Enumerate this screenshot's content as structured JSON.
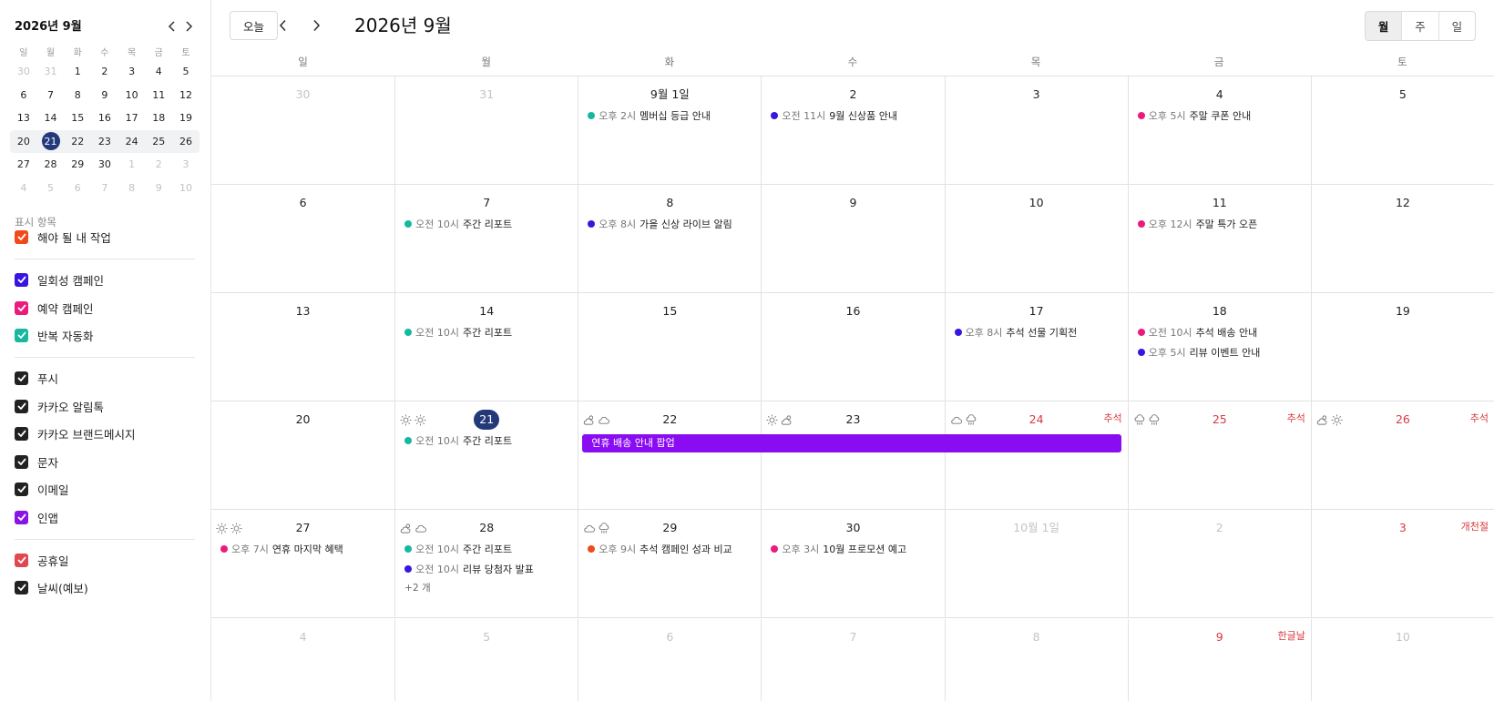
{
  "sidebar": {
    "mini_title": "2026년 9월",
    "dow": [
      "일",
      "월",
      "화",
      "수",
      "목",
      "금",
      "토"
    ],
    "weeks": [
      [
        {
          "d": "30",
          "m": true
        },
        {
          "d": "31",
          "m": true
        },
        {
          "d": "1"
        },
        {
          "d": "2"
        },
        {
          "d": "3"
        },
        {
          "d": "4"
        },
        {
          "d": "5"
        }
      ],
      [
        {
          "d": "6"
        },
        {
          "d": "7"
        },
        {
          "d": "8"
        },
        {
          "d": "9"
        },
        {
          "d": "10"
        },
        {
          "d": "11"
        },
        {
          "d": "12"
        }
      ],
      [
        {
          "d": "13"
        },
        {
          "d": "14"
        },
        {
          "d": "15"
        },
        {
          "d": "16"
        },
        {
          "d": "17"
        },
        {
          "d": "18"
        },
        {
          "d": "19"
        }
      ],
      [
        {
          "d": "20"
        },
        {
          "d": "21",
          "today": true
        },
        {
          "d": "22"
        },
        {
          "d": "23"
        },
        {
          "d": "24"
        },
        {
          "d": "25"
        },
        {
          "d": "26"
        }
      ],
      [
        {
          "d": "27"
        },
        {
          "d": "28"
        },
        {
          "d": "29"
        },
        {
          "d": "30"
        },
        {
          "d": "1",
          "m": true
        },
        {
          "d": "2",
          "m": true
        },
        {
          "d": "3",
          "m": true
        }
      ],
      [
        {
          "d": "4",
          "m": true
        },
        {
          "d": "5",
          "m": true
        },
        {
          "d": "6",
          "m": true
        },
        {
          "d": "7",
          "m": true
        },
        {
          "d": "8",
          "m": true
        },
        {
          "d": "9",
          "m": true
        },
        {
          "d": "10",
          "m": true
        }
      ]
    ],
    "section_label": "표시 항목",
    "filters": [
      {
        "label": "해야 될 내 작업",
        "color": "#f04a1a"
      },
      {
        "label": "일회성 캠페인",
        "color": "#3a14e0"
      },
      {
        "label": "예약 캠페인",
        "color": "#ec1a7c"
      },
      {
        "label": "반복 자동화",
        "color": "#16b8a0"
      },
      {
        "label": "푸시",
        "color": "#222222"
      },
      {
        "label": "카카오 알림톡",
        "color": "#222222"
      },
      {
        "label": "카카오 브랜드메시지",
        "color": "#222222"
      },
      {
        "label": "문자",
        "color": "#222222"
      },
      {
        "label": "이메일",
        "color": "#222222"
      },
      {
        "label": "인앱",
        "color": "#8a14e6"
      },
      {
        "label": "공휴일",
        "color": "#e0474f"
      },
      {
        "label": "날씨(예보)",
        "color": "#222222"
      }
    ]
  },
  "toolbar": {
    "today_label": "오늘",
    "title": "2026년 9월",
    "views": [
      {
        "label": "월",
        "active": true
      },
      {
        "label": "주",
        "active": false
      },
      {
        "label": "일",
        "active": false
      }
    ]
  },
  "calendar": {
    "dow": [
      "일",
      "월",
      "화",
      "수",
      "목",
      "금",
      "토"
    ],
    "weeks": [
      [
        {
          "label": "30",
          "muted": true
        },
        {
          "label": "31",
          "muted": true
        },
        {
          "label": "9월 1일",
          "events": [
            {
              "color": "#16b8a0",
              "time": "오후 2시",
              "title": "멤버십 등급 안내"
            }
          ]
        },
        {
          "label": "2",
          "events": [
            {
              "color": "#3a14e0",
              "time": "오전 11시",
              "title": "9월 신상품 안내"
            }
          ]
        },
        {
          "label": "3"
        },
        {
          "label": "4",
          "events": [
            {
              "color": "#ec1a7c",
              "time": "오후 5시",
              "title": "주말 쿠폰 안내"
            }
          ]
        },
        {
          "label": "5"
        }
      ],
      [
        {
          "label": "6"
        },
        {
          "label": "7",
          "events": [
            {
              "color": "#16b8a0",
              "time": "오전 10시",
              "title": "주간 리포트"
            }
          ]
        },
        {
          "label": "8",
          "events": [
            {
              "color": "#3a14e0",
              "time": "오후 8시",
              "title": "가을 신상 라이브 알림"
            }
          ]
        },
        {
          "label": "9"
        },
        {
          "label": "10"
        },
        {
          "label": "11",
          "events": [
            {
              "color": "#ec1a7c",
              "time": "오후 12시",
              "title": "주말 특가 오픈"
            }
          ]
        },
        {
          "label": "12"
        }
      ],
      [
        {
          "label": "13"
        },
        {
          "label": "14",
          "events": [
            {
              "color": "#16b8a0",
              "time": "오전 10시",
              "title": "주간 리포트"
            }
          ]
        },
        {
          "label": "15"
        },
        {
          "label": "16"
        },
        {
          "label": "17",
          "events": [
            {
              "color": "#3a14e0",
              "time": "오후 8시",
              "title": "추석 선물 기획전"
            }
          ]
        },
        {
          "label": "18",
          "events": [
            {
              "color": "#ec1a7c",
              "time": "오전 10시",
              "title": "추석 배송 안내"
            },
            {
              "color": "#3a14e0",
              "time": "오후 5시",
              "title": "리뷰 이벤트 안내"
            }
          ]
        },
        {
          "label": "19"
        }
      ],
      [
        {
          "label": "20"
        },
        {
          "label": "21",
          "today": true,
          "weather": [
            "sun",
            "sun"
          ],
          "events": [
            {
              "color": "#16b8a0",
              "time": "오전 10시",
              "title": "주간 리포트"
            }
          ]
        },
        {
          "label": "22",
          "weather": [
            "partly",
            "cloud"
          ]
        },
        {
          "label": "23",
          "weather": [
            "sun",
            "partly"
          ]
        },
        {
          "label": "24",
          "red": true,
          "holiday": "추석",
          "weather": [
            "cloud",
            "rain"
          ]
        },
        {
          "label": "25",
          "red": true,
          "holiday": "추석",
          "weather": [
            "rain",
            "rain"
          ]
        },
        {
          "label": "26",
          "red": true,
          "holiday": "추석",
          "weather": [
            "partly",
            "sun"
          ]
        }
      ],
      [
        {
          "label": "27",
          "weather": [
            "sun",
            "sun"
          ],
          "events": [
            {
              "color": "#ec1a7c",
              "time": "오후 7시",
              "title": "연휴 마지막 혜택"
            }
          ]
        },
        {
          "label": "28",
          "weather": [
            "partly",
            "cloud"
          ],
          "events": [
            {
              "color": "#16b8a0",
              "time": "오전 10시",
              "title": "주간 리포트"
            },
            {
              "color": "#3a14e0",
              "time": "오전 10시",
              "title": "리뷰 당첨자 발표"
            }
          ],
          "more": "+2 개"
        },
        {
          "label": "29",
          "weather": [
            "cloud",
            "rain"
          ],
          "events": [
            {
              "color": "#f04a1a",
              "time": "오후 9시",
              "title": "추석 캠페인 성과 비교"
            }
          ]
        },
        {
          "label": "30",
          "events": [
            {
              "color": "#ec1a7c",
              "time": "오후 3시",
              "title": "10월 프로모션 예고"
            }
          ]
        },
        {
          "label": "10월 1일",
          "muted": true
        },
        {
          "label": "2",
          "muted": true
        },
        {
          "label": "3",
          "red": true,
          "holiday": "개천절"
        }
      ],
      [
        {
          "label": "4",
          "muted": true
        },
        {
          "label": "5",
          "muted": true
        },
        {
          "label": "6",
          "muted": true
        },
        {
          "label": "7",
          "muted": true
        },
        {
          "label": "8",
          "muted": true
        },
        {
          "label": "9",
          "red": true,
          "holiday": "한글날"
        },
        {
          "label": "10",
          "muted": true
        }
      ]
    ],
    "span_events": [
      {
        "title": "연휴 배송 안내 팝업",
        "color": "#8a0cf0",
        "week": 3,
        "start": 2,
        "end": 4
      }
    ]
  }
}
